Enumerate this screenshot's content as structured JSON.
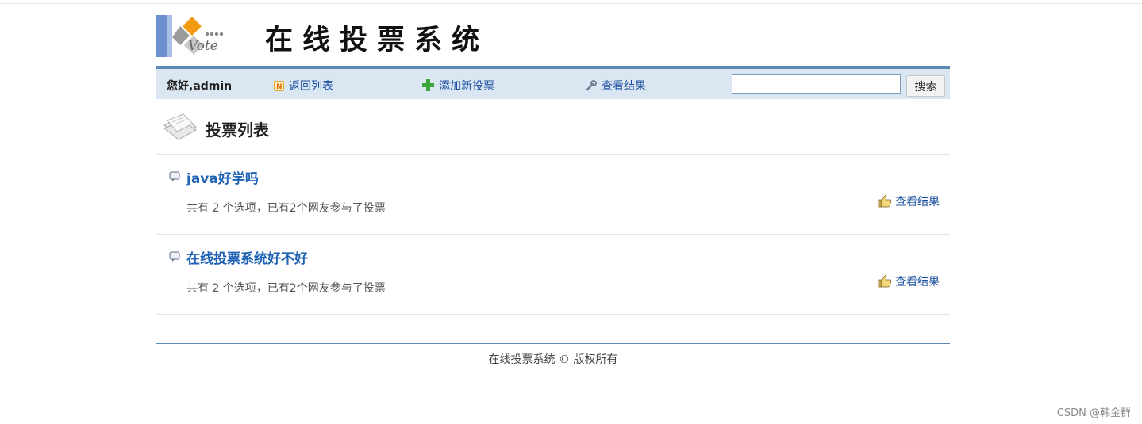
{
  "header": {
    "logo_text": "Vote",
    "site_title": "在线投票系统"
  },
  "nav": {
    "greeting": "您好,admin",
    "back_label": "返回列表",
    "add_label": "添加新投票",
    "result_label": "查看结果",
    "search_value": "",
    "search_button": "搜索"
  },
  "section": {
    "title": "投票列表"
  },
  "votes": [
    {
      "title": "java好学吗",
      "meta": "共有 2 个选项，已有2个网友参与了投票",
      "result_label": "查看结果"
    },
    {
      "title": "在线投票系统好不好",
      "meta": "共有 2 个选项，已有2个网友参与了投票",
      "result_label": "查看结果"
    }
  ],
  "footer": {
    "text": "在线投票系统 © 版权所有"
  },
  "watermark": "CSDN @韩金群",
  "colors": {
    "nav_bg": "#dbe6f3",
    "nav_border": "#5b8bb5",
    "link": "#1b4f9e",
    "vote_title": "#1f62b3"
  }
}
